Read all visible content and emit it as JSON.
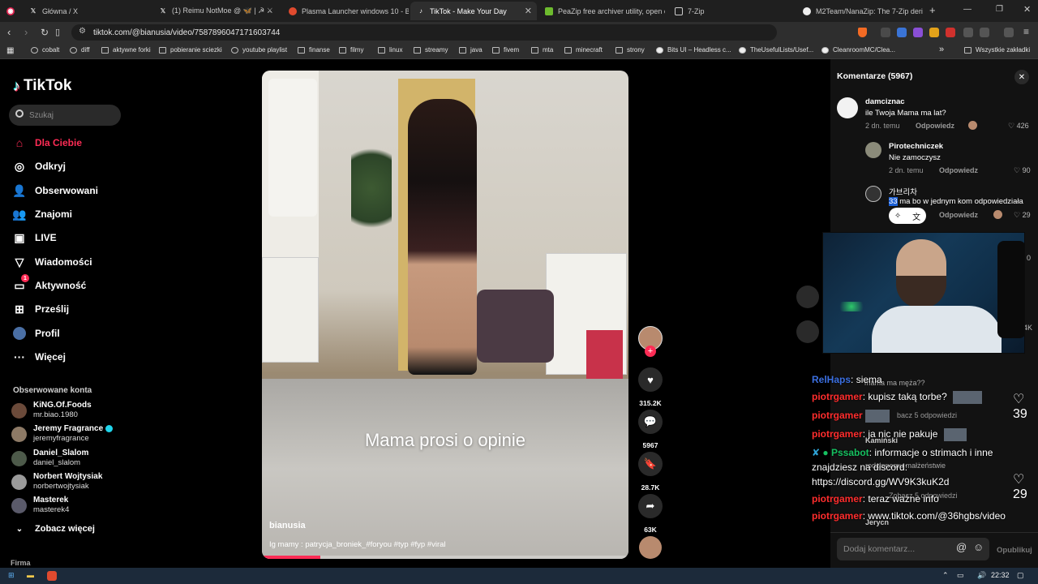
{
  "browser": {
    "tabs": [
      {
        "title": "Główna / X",
        "favicon": "x-logo-icon",
        "active": false
      },
      {
        "title": "(1) Reimu NotMoe @ 🦋 | ☭ ⚔",
        "favicon": "x-logo-icon",
        "active": false
      },
      {
        "title": "Plasma Launcher windows 10 - Brav",
        "favicon": "brave-icon",
        "active": false
      },
      {
        "title": "TikTok - Make Your Day",
        "favicon": "tiktok-icon",
        "active": true
      },
      {
        "title": "PeaZip free archiver utility, open ext",
        "favicon": "peazip-icon",
        "active": false
      },
      {
        "title": "7-Zip",
        "favicon": "7zip-icon",
        "active": false
      },
      {
        "title": "M2Team/NanaZip: The 7-Zip deriva",
        "favicon": "github-icon",
        "active": false
      }
    ],
    "new_tab": "+",
    "url": "tiktok.com/@bianusia/video/7587896047171603744",
    "bookmarks": [
      "cobalt",
      "diff",
      "aktywne forki",
      "pobieranie sciezki",
      "youtube playlist",
      "finanse",
      "filmy",
      "linux",
      "streamy",
      "java",
      "fivem",
      "mta",
      "minecraft",
      "strony",
      "Bits UI – Headless c...",
      "TheUsefulLists/Usef...",
      "CleanroomMC/Clea..."
    ],
    "bookmarks_overflow": "»",
    "all_bookmarks": "Wszystkie zakładki"
  },
  "sidebar": {
    "logo": "TikTok",
    "search_placeholder": "Szukaj",
    "nav": [
      {
        "label": "Dla Ciebie",
        "icon": "home-icon",
        "active": true
      },
      {
        "label": "Odkryj",
        "icon": "compass-icon"
      },
      {
        "label": "Obserwowani",
        "icon": "following-icon"
      },
      {
        "label": "Znajomi",
        "icon": "friends-icon"
      },
      {
        "label": "LIVE",
        "icon": "live-icon"
      },
      {
        "label": "Wiadomości",
        "icon": "messages-icon"
      },
      {
        "label": "Aktywność",
        "icon": "activity-icon",
        "badge": "1"
      },
      {
        "label": "Prześlij",
        "icon": "upload-icon"
      },
      {
        "label": "Profil",
        "icon": "profile-icon"
      },
      {
        "label": "Więcej",
        "icon": "more-icon"
      }
    ],
    "followed_title": "Obserwowane konta",
    "accounts": [
      {
        "name": "KiNG.Of.Foods",
        "user": "mr.biao.1980"
      },
      {
        "name": "Jeremy Fragrance",
        "user": "jeremyfragrance",
        "verified": true
      },
      {
        "name": "Daniel_Slalom",
        "user": "daniel_slalom"
      },
      {
        "name": "Norbert Wojtysiak",
        "user": "norbertwojtysiak"
      },
      {
        "name": "Masterek",
        "user": "masterek4"
      }
    ],
    "see_more": "Zobacz więcej",
    "footer": "Firma"
  },
  "video": {
    "overlay_text": "Mama prosi o opinie",
    "author": "bianusia",
    "caption": "Ig mamy : patrycja_broniek_#foryou #typ #fyp #viral",
    "progress": 0.16
  },
  "actions": {
    "likes": "315.2K",
    "comments": "5967",
    "saves": "28.7K",
    "shares": "63K"
  },
  "comments": {
    "title": "Komentarze (5967)",
    "items": [
      {
        "user": "damciznac",
        "text": "ile Twoja Mama ma lat?",
        "time": "2 dn. temu",
        "reply": "Odpowiedz",
        "likes": "426"
      },
      {
        "user": "Pirotechniczek",
        "text": "Nie zamoczysz",
        "time": "2 dn. temu",
        "reply": "Odpowiedz",
        "likes": "90"
      },
      {
        "user": "가브리차",
        "text_highlight": "33",
        "text": " ma bo w jednym kom odpowiedziała",
        "reply": "Odpowiedz",
        "likes": "29"
      }
    ],
    "right_edge_values": [
      "0",
      "4K",
      "39",
      "29"
    ],
    "input_placeholder": "Dodaj komentarz...",
    "publish": "Opublikuj"
  },
  "chat": [
    {
      "name": "RelHaps",
      "text": ": siema"
    },
    {
      "name": "piotrgamer",
      "text": ": kupisz taką torbe?"
    },
    {
      "name": "piotrgamer",
      "text": ": ja nic nie pakuje"
    },
    {
      "name": "Pssabot",
      "text": ": informacje o strimach i inne",
      "color": "#16c060"
    },
    {
      "name": "",
      "text": "znajdziesz na discord:"
    },
    {
      "name": "",
      "text": "https://discord.gg/WV9K3kuK2d"
    },
    {
      "name": "piotrgamer",
      "text": ": teraz ważne info"
    },
    {
      "name": "piotrgamer",
      "text": ": www.tiktok.com/@36hgbs/video"
    }
  ],
  "ghost_comments": {
    "a": "mama ma męża??",
    "b": "bacz 5 odpowiedzi",
    "c": "Kamiński",
    "d": "rodzinnemu małżeństwie",
    "e": "Zobacz 5 odpowiedzi",
    "f": "Jerycn"
  },
  "taskbar": {
    "time": "22:32"
  },
  "colors": {
    "tiktok_red": "#fe2c55",
    "chat_name": "#ff2d2d",
    "bot_name": "#16c060"
  }
}
